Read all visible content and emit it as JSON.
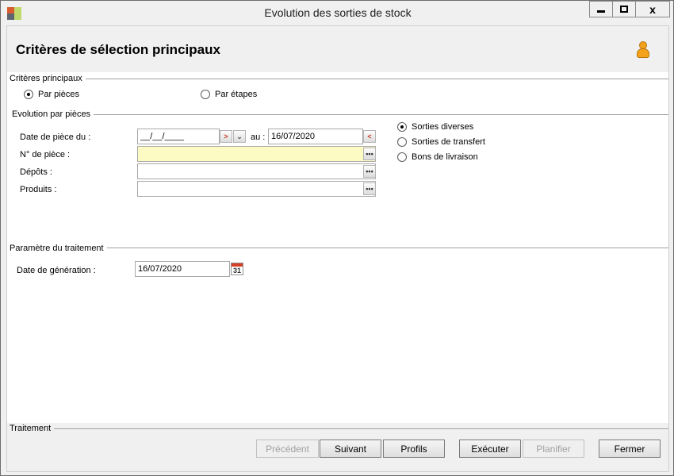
{
  "window": {
    "title": "Evolution des sorties de stock",
    "close_label": "x"
  },
  "header": {
    "title": "Critères de sélection principaux"
  },
  "criteria": {
    "label": "Critères principaux",
    "options": [
      {
        "label": "Par pièces",
        "selected": true
      },
      {
        "label": "Par étapes",
        "selected": false
      }
    ]
  },
  "evolution": {
    "label": "Evolution par pièces",
    "date_from_label": "Date de pièce du :",
    "date_from_value": "__/__/____",
    "au_label": "au :",
    "date_to_value": "16/07/2020",
    "piece_label": "N° de pièce :",
    "piece_value": "",
    "depots_label": "Dépôts :",
    "depots_value": "",
    "produits_label": "Produits :",
    "produits_value": "",
    "lookup_glyph": "•••",
    "type_options": [
      {
        "label": "Sorties diverses",
        "selected": true
      },
      {
        "label": "Sorties de transfert",
        "selected": false
      },
      {
        "label": "Bons de livraison",
        "selected": false
      }
    ]
  },
  "treatment_params": {
    "label": "Paramètre du traitement",
    "gen_date_label": "Date de génération :",
    "gen_date_value": "16/07/2020",
    "calendar_day": "31"
  },
  "footer": {
    "label": "Traitement",
    "buttons": [
      {
        "label": "Précédent",
        "enabled": false
      },
      {
        "label": "Suivant",
        "enabled": true
      },
      {
        "label": "Profils",
        "enabled": true
      },
      {
        "label": "Exécuter",
        "enabled": true
      },
      {
        "label": "Planifier",
        "enabled": false
      },
      {
        "label": "Fermer",
        "enabled": true
      }
    ]
  },
  "colors": {
    "required_field": "#fdfbc4",
    "accent_red": "#c63a1f",
    "user_icon": "#f4a21b"
  }
}
